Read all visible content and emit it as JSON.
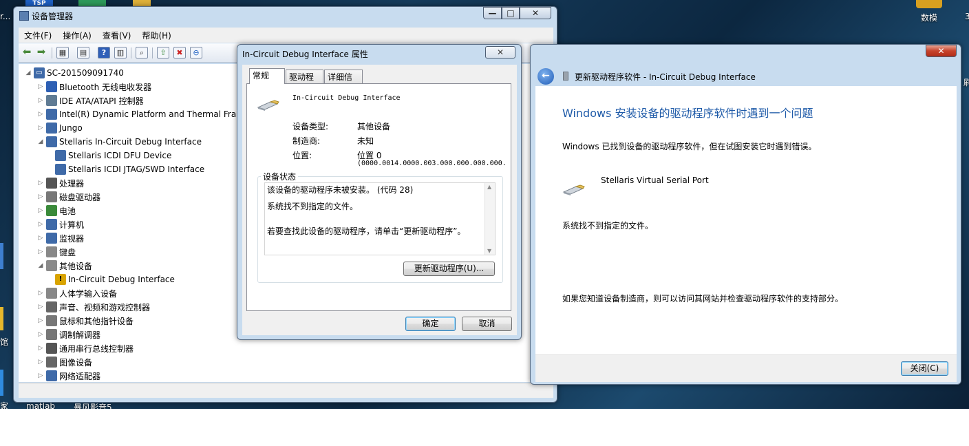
{
  "desktop": {
    "left_label_top": "r...",
    "right_icon_label": "数模",
    "right_edge_label": "3",
    "left_side_label_1": "馆",
    "left_side_label_2": "家",
    "taskbar_labels": [
      "matlab",
      "暴风影音5"
    ],
    "right_side_label": "刷"
  },
  "device_manager": {
    "title": "设备管理器",
    "menu": [
      "文件(F)",
      "操作(A)",
      "查看(V)",
      "帮助(H)"
    ],
    "root": "SC-201509091740",
    "tree": [
      {
        "label": "Bluetooth 无线电收发器",
        "level": 1,
        "expander": "▷",
        "icon": "bluetooth-icon",
        "color": "#2d5fb3"
      },
      {
        "label": "IDE ATA/ATAPI 控制器",
        "level": 1,
        "expander": "▷",
        "icon": "ide-controller-icon",
        "color": "#5f7b94"
      },
      {
        "label": "Intel(R) Dynamic Platform and Thermal Fram",
        "level": 1,
        "expander": "▷",
        "icon": "device-icon",
        "color": "#3f6aa8"
      },
      {
        "label": "Jungo",
        "level": 1,
        "expander": "▷",
        "icon": "device-icon",
        "color": "#3f6aa8"
      },
      {
        "label": "Stellaris In-Circuit Debug Interface",
        "level": 1,
        "expander": "◢",
        "icon": "device-icon",
        "color": "#3f6aa8"
      },
      {
        "label": "Stellaris ICDI DFU Device",
        "level": 2,
        "expander": "",
        "icon": "device-icon",
        "color": "#3f6aa8"
      },
      {
        "label": "Stellaris ICDI JTAG/SWD Interface",
        "level": 2,
        "expander": "",
        "icon": "device-icon",
        "color": "#3f6aa8"
      },
      {
        "label": "处理器",
        "level": 1,
        "expander": "▷",
        "icon": "processor-icon",
        "color": "#555555"
      },
      {
        "label": "磁盘驱动器",
        "level": 1,
        "expander": "▷",
        "icon": "disk-drive-icon",
        "color": "#777777"
      },
      {
        "label": "电池",
        "level": 1,
        "expander": "▷",
        "icon": "battery-icon",
        "color": "#3a8a3a"
      },
      {
        "label": "计算机",
        "level": 1,
        "expander": "▷",
        "icon": "computer-icon",
        "color": "#3f6aa8"
      },
      {
        "label": "监视器",
        "level": 1,
        "expander": "▷",
        "icon": "monitor-icon",
        "color": "#3f6aa8"
      },
      {
        "label": "键盘",
        "level": 1,
        "expander": "▷",
        "icon": "keyboard-icon",
        "color": "#888888"
      },
      {
        "label": "其他设备",
        "level": 1,
        "expander": "◢",
        "icon": "other-devices-icon",
        "color": "#8a8a8a"
      },
      {
        "label": "In-Circuit Debug Interface",
        "level": 2,
        "expander": "",
        "icon": "warning-device-icon",
        "color": "#d9a400"
      },
      {
        "label": "人体学输入设备",
        "level": 1,
        "expander": "▷",
        "icon": "hid-icon",
        "color": "#888888"
      },
      {
        "label": "声音、视频和游戏控制器",
        "level": 1,
        "expander": "▷",
        "icon": "speaker-icon",
        "color": "#666666"
      },
      {
        "label": "鼠标和其他指针设备",
        "level": 1,
        "expander": "▷",
        "icon": "mouse-icon",
        "color": "#777777"
      },
      {
        "label": "调制解调器",
        "level": 1,
        "expander": "▷",
        "icon": "modem-icon",
        "color": "#777777"
      },
      {
        "label": "通用串行总线控制器",
        "level": 1,
        "expander": "▷",
        "icon": "usb-icon",
        "color": "#555555"
      },
      {
        "label": "图像设备",
        "level": 1,
        "expander": "▷",
        "icon": "camera-icon",
        "color": "#666666"
      },
      {
        "label": "网络适配器",
        "level": 1,
        "expander": "▷",
        "icon": "network-adapter-icon",
        "color": "#3f6aa8"
      }
    ]
  },
  "properties": {
    "title": "In-Circuit Debug Interface 属性",
    "tabs": [
      "常规",
      "驱动程序",
      "详细信息"
    ],
    "device_name": "In-Circuit Debug Interface",
    "rows": [
      {
        "label": "设备类型:",
        "value": "其他设备"
      },
      {
        "label": "制造商:",
        "value": "未知"
      },
      {
        "label": "位置:",
        "value": "位置 0"
      }
    ],
    "location_detail": "(0000.0014.0000.003.000.000.000.000.",
    "status_group": "设备状态",
    "status_lines": [
      "该设备的驱动程序未被安装。 (代码 28)",
      "系统找不到指定的文件。",
      "",
      "若要查找此设备的驱动程序，请单击“更新驱动程序”。"
    ],
    "update_button": "更新驱动程序(U)...",
    "ok": "确定",
    "cancel": "取消"
  },
  "update_driver": {
    "title": "更新驱动程序软件 - In-Circuit Debug Interface",
    "heading": "Windows 安装设备的驱动程序软件时遇到一个问题",
    "line1": "Windows 已找到设备的驱动程序软件，但在试图安装它时遇到错误。",
    "device": "Stellaris Virtual Serial Port",
    "error": "系统找不到指定的文件。",
    "hint": "如果您知道设备制造商，则可以访问其网站并检查驱动程序软件的支持部分。",
    "close": "关闭(C)",
    "heading_color": "#1e5aa8"
  }
}
